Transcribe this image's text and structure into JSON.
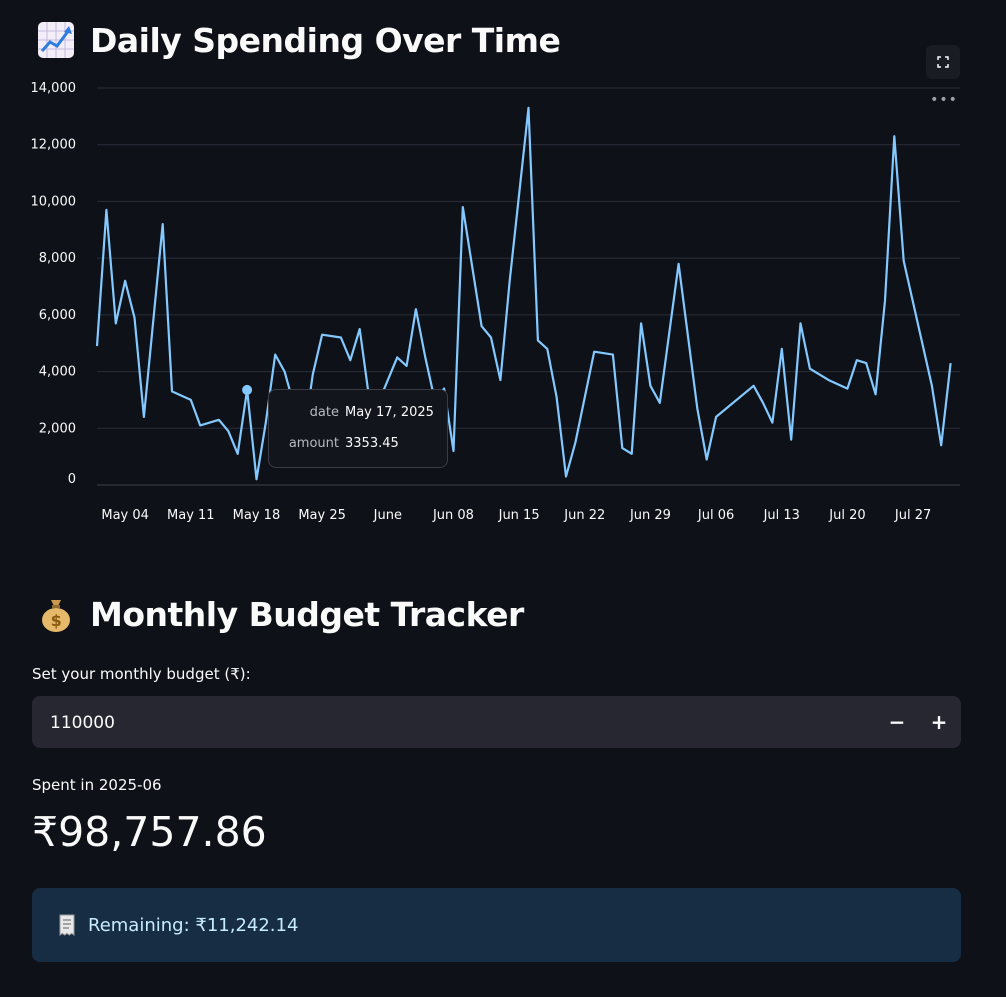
{
  "chart_section": {
    "title": "Daily Spending Over Time",
    "title_icon": "chart-increasing-icon",
    "fullscreen_icon": "fullscreen-icon",
    "more_icon": "more-options-icon",
    "more_glyph": "•••"
  },
  "tooltip": {
    "date_key": "date",
    "date_value": "May 17, 2025",
    "amount_key": "amount",
    "amount_value": "3353.45"
  },
  "chart_data": {
    "type": "line",
    "title": "",
    "xlabel": "",
    "ylabel": "",
    "ylim": [
      0,
      14000
    ],
    "y_ticks": [
      "0",
      "2,000",
      "4,000",
      "6,000",
      "8,000",
      "10,000",
      "12,000",
      "14,000"
    ],
    "x_ticks": [
      "May 04",
      "May 11",
      "May 18",
      "May 25",
      "June",
      "Jun 08",
      "Jun 15",
      "Jun 22",
      "Jun 29",
      "Jul 06",
      "Jul 13",
      "Jul 20",
      "Jul 27"
    ],
    "x_start": "2025-05-01",
    "x_end": "2025-08-01",
    "line_color": "#83c9ff",
    "grid": true,
    "highlight": {
      "date": "2025-05-17",
      "amount": 3353.45
    },
    "points": [
      {
        "date": "2025-05-01",
        "amount": 4900
      },
      {
        "date": "2025-05-02",
        "amount": 9700
      },
      {
        "date": "2025-05-03",
        "amount": 5700
      },
      {
        "date": "2025-05-04",
        "amount": 7200
      },
      {
        "date": "2025-05-05",
        "amount": 5900
      },
      {
        "date": "2025-05-06",
        "amount": 2400
      },
      {
        "date": "2025-05-08",
        "amount": 9200
      },
      {
        "date": "2025-05-09",
        "amount": 3300
      },
      {
        "date": "2025-05-11",
        "amount": 3000
      },
      {
        "date": "2025-05-12",
        "amount": 2100
      },
      {
        "date": "2025-05-14",
        "amount": 2300
      },
      {
        "date": "2025-05-15",
        "amount": 1900
      },
      {
        "date": "2025-05-16",
        "amount": 1100
      },
      {
        "date": "2025-05-17",
        "amount": 3353.45
      },
      {
        "date": "2025-05-18",
        "amount": 200
      },
      {
        "date": "2025-05-19",
        "amount": 2200
      },
      {
        "date": "2025-05-20",
        "amount": 4600
      },
      {
        "date": "2025-05-21",
        "amount": 4000
      },
      {
        "date": "2025-05-23",
        "amount": 1600
      },
      {
        "date": "2025-05-24",
        "amount": 3900
      },
      {
        "date": "2025-05-25",
        "amount": 5300
      },
      {
        "date": "2025-05-27",
        "amount": 5200
      },
      {
        "date": "2025-05-28",
        "amount": 4400
      },
      {
        "date": "2025-05-29",
        "amount": 5500
      },
      {
        "date": "2025-05-30",
        "amount": 3100
      },
      {
        "date": "2025-05-31",
        "amount": 2900
      },
      {
        "date": "2025-06-02",
        "amount": 4500
      },
      {
        "date": "2025-06-03",
        "amount": 4200
      },
      {
        "date": "2025-06-04",
        "amount": 6200
      },
      {
        "date": "2025-06-05",
        "amount": 4500
      },
      {
        "date": "2025-06-06",
        "amount": 3000
      },
      {
        "date": "2025-06-07",
        "amount": 3400
      },
      {
        "date": "2025-06-08",
        "amount": 1200
      },
      {
        "date": "2025-06-09",
        "amount": 9800
      },
      {
        "date": "2025-06-11",
        "amount": 5600
      },
      {
        "date": "2025-06-12",
        "amount": 5200
      },
      {
        "date": "2025-06-13",
        "amount": 3700
      },
      {
        "date": "2025-06-14",
        "amount": 7200
      },
      {
        "date": "2025-06-16",
        "amount": 13300
      },
      {
        "date": "2025-06-17",
        "amount": 5100
      },
      {
        "date": "2025-06-18",
        "amount": 4800
      },
      {
        "date": "2025-06-19",
        "amount": 3100
      },
      {
        "date": "2025-06-20",
        "amount": 300
      },
      {
        "date": "2025-06-21",
        "amount": 1500
      },
      {
        "date": "2025-06-23",
        "amount": 4700
      },
      {
        "date": "2025-06-25",
        "amount": 4600
      },
      {
        "date": "2025-06-26",
        "amount": 1300
      },
      {
        "date": "2025-06-27",
        "amount": 1100
      },
      {
        "date": "2025-06-28",
        "amount": 5700
      },
      {
        "date": "2025-06-29",
        "amount": 3500
      },
      {
        "date": "2025-06-30",
        "amount": 2900
      },
      {
        "date": "2025-07-02",
        "amount": 7800
      },
      {
        "date": "2025-07-04",
        "amount": 2700
      },
      {
        "date": "2025-07-05",
        "amount": 900
      },
      {
        "date": "2025-07-06",
        "amount": 2400
      },
      {
        "date": "2025-07-10",
        "amount": 3500
      },
      {
        "date": "2025-07-11",
        "amount": 2900
      },
      {
        "date": "2025-07-12",
        "amount": 2200
      },
      {
        "date": "2025-07-13",
        "amount": 4800
      },
      {
        "date": "2025-07-14",
        "amount": 1600
      },
      {
        "date": "2025-07-15",
        "amount": 5700
      },
      {
        "date": "2025-07-16",
        "amount": 4100
      },
      {
        "date": "2025-07-18",
        "amount": 3700
      },
      {
        "date": "2025-07-20",
        "amount": 3400
      },
      {
        "date": "2025-07-21",
        "amount": 4400
      },
      {
        "date": "2025-07-22",
        "amount": 4300
      },
      {
        "date": "2025-07-23",
        "amount": 3200
      },
      {
        "date": "2025-07-24",
        "amount": 6500
      },
      {
        "date": "2025-07-25",
        "amount": 12300
      },
      {
        "date": "2025-07-26",
        "amount": 7900
      },
      {
        "date": "2025-07-29",
        "amount": 3500
      },
      {
        "date": "2025-07-30",
        "amount": 1400
      },
      {
        "date": "2025-07-31",
        "amount": 4300
      }
    ]
  },
  "budget_section": {
    "title": "Monthly Budget Tracker",
    "title_icon": "money-bag-icon",
    "budget_label": "Set your monthly budget (₹):",
    "budget_value": "110000",
    "decrement_label": "−",
    "increment_label": "+",
    "spent_label": "Spent in 2025-06",
    "spent_value": "₹98,757.86",
    "remaining_icon": "receipt-icon",
    "remaining_text": "Remaining: ₹11,242.14"
  }
}
